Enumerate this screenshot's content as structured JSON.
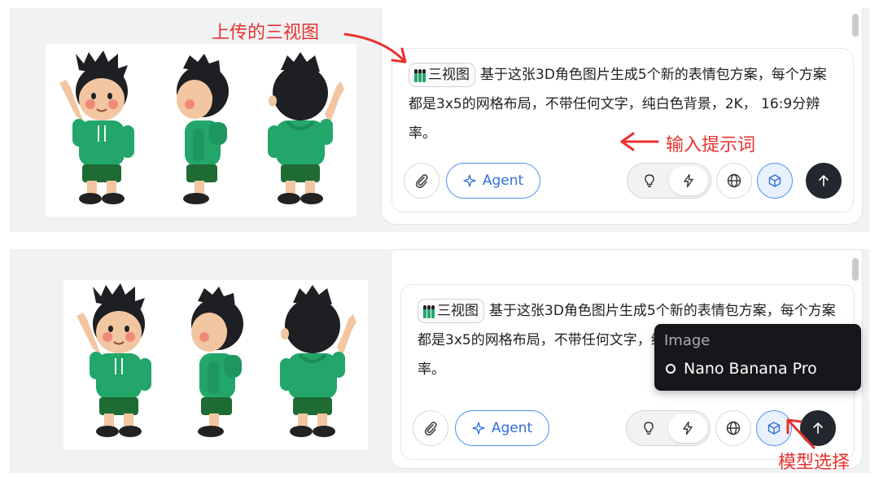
{
  "colors": {
    "accent_blue": "#4a8ef0",
    "annotation_red": "#e8322f",
    "send_button": "#23272e",
    "dropdown_bg": "#16171a",
    "hoodie_green": "#22a66a"
  },
  "chip": {
    "label": "三视图",
    "icon": "three-figures-icon"
  },
  "prompt_text": "基于这张3D角色图片生成5个新的表情包方案，每个方案都是3x5的网格布局，不带任何文字，纯白色背景，2K， 16:9分辨率。",
  "toolbar": {
    "attach_icon": "paperclip-icon",
    "agent_label": "Agent",
    "agent_icon": "sparkle-icon",
    "idea_icon": "lightbulb-icon",
    "fast_icon": "lightning-icon",
    "web_icon": "globe-icon",
    "model_icon": "cube-icon",
    "send_icon": "arrow-up-icon"
  },
  "dropdown": {
    "header": "Image",
    "selected": "Nano Banana Pro"
  },
  "annotations": {
    "uploaded_three_view": "上传的三视图",
    "enter_prompt": "输入提示词",
    "model_selection": "模型选择"
  }
}
